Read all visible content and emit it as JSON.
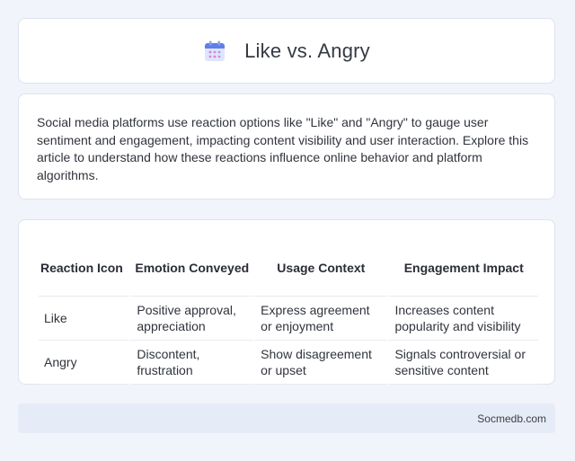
{
  "header": {
    "title": "Like vs. Angry",
    "icon": "calendar-icon"
  },
  "intro": {
    "text": "Social media platforms use reaction options like \"Like\" and \"Angry\" to gauge user sentiment and engagement, impacting content visibility and user interaction. Explore this article to understand how these reactions influence online behavior and platform algorithms."
  },
  "table": {
    "headers": [
      "Reaction Icon",
      "Emotion Conveyed",
      "Usage Context",
      "Engagement Impact"
    ],
    "rows": [
      [
        "Like",
        "Positive approval, appreciation",
        "Express agreement or enjoyment",
        "Increases content popularity and visibility"
      ],
      [
        "Angry",
        "Discontent, frustration",
        "Show disagreement or upset",
        "Signals controversial or sensitive content"
      ]
    ]
  },
  "footer": {
    "text": "Socmedb.com"
  },
  "colors": {
    "background": "#f1f4fa",
    "card": "#ffffff",
    "footer": "#e6ecf7"
  }
}
